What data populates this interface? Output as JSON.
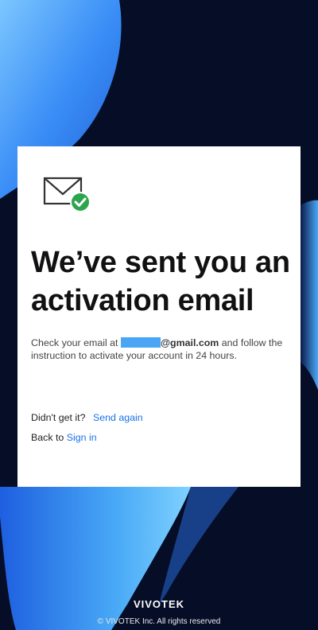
{
  "colors": {
    "background": "#060d26",
    "accent_blue": "#49a6f4",
    "link": "#1a73e8",
    "success_green": "#2da44e"
  },
  "card": {
    "icon": "mail-check-icon",
    "headline": "We’ve sent you an activation email",
    "desc_prefix": "Check your email at ",
    "email_domain": "@gmail.com",
    "desc_suffix": " and follow the instruction to activate your account in 24 hours.",
    "resend_prompt": "Didn't get it?",
    "resend_link": "Send again",
    "back_prefix": "Back to ",
    "signin_link": "Sign in"
  },
  "footer": {
    "logo": "VIVOTEK",
    "copyright": "© VIVOTEK Inc. All rights reserved"
  }
}
